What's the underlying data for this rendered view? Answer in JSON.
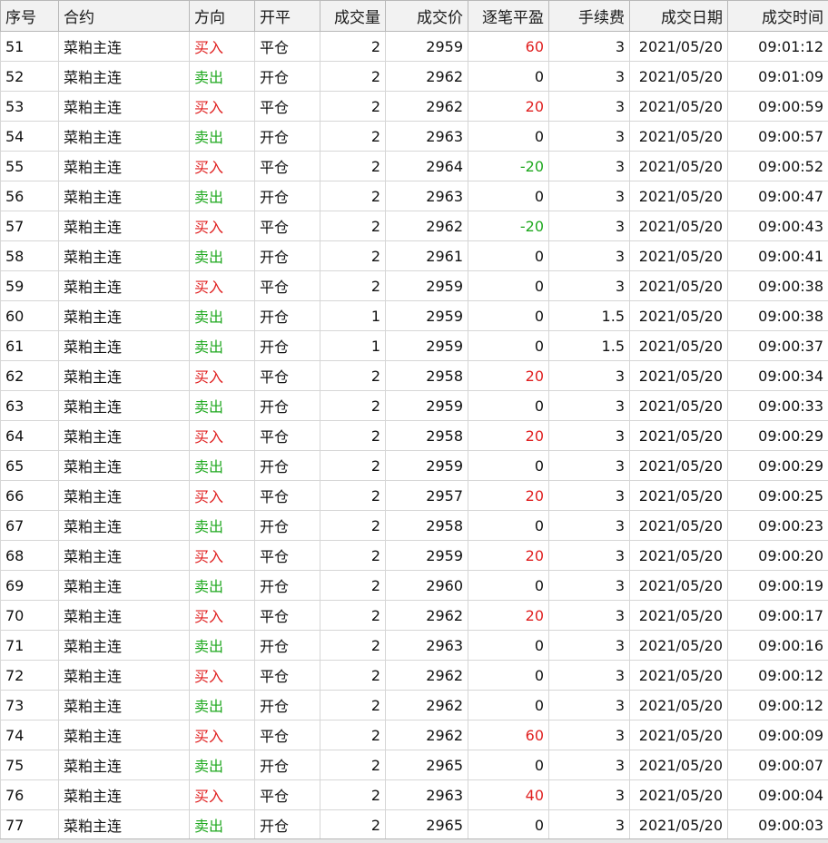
{
  "columns": [
    "序号",
    "合约",
    "方向",
    "开平",
    "成交量",
    "成交价",
    "逐笔平盈",
    "手续费",
    "成交日期",
    "成交时间"
  ],
  "rows": [
    [
      "51",
      "菜粕主连",
      "买入",
      "平仓",
      "2",
      "2959",
      "60",
      "3",
      "2021/05/20",
      "09:01:12"
    ],
    [
      "52",
      "菜粕主连",
      "卖出",
      "开仓",
      "2",
      "2962",
      "0",
      "3",
      "2021/05/20",
      "09:01:09"
    ],
    [
      "53",
      "菜粕主连",
      "买入",
      "平仓",
      "2",
      "2962",
      "20",
      "3",
      "2021/05/20",
      "09:00:59"
    ],
    [
      "54",
      "菜粕主连",
      "卖出",
      "开仓",
      "2",
      "2963",
      "0",
      "3",
      "2021/05/20",
      "09:00:57"
    ],
    [
      "55",
      "菜粕主连",
      "买入",
      "平仓",
      "2",
      "2964",
      "-20",
      "3",
      "2021/05/20",
      "09:00:52"
    ],
    [
      "56",
      "菜粕主连",
      "卖出",
      "开仓",
      "2",
      "2963",
      "0",
      "3",
      "2021/05/20",
      "09:00:47"
    ],
    [
      "57",
      "菜粕主连",
      "买入",
      "平仓",
      "2",
      "2962",
      "-20",
      "3",
      "2021/05/20",
      "09:00:43"
    ],
    [
      "58",
      "菜粕主连",
      "卖出",
      "开仓",
      "2",
      "2961",
      "0",
      "3",
      "2021/05/20",
      "09:00:41"
    ],
    [
      "59",
      "菜粕主连",
      "买入",
      "平仓",
      "2",
      "2959",
      "0",
      "3",
      "2021/05/20",
      "09:00:38"
    ],
    [
      "60",
      "菜粕主连",
      "卖出",
      "开仓",
      "1",
      "2959",
      "0",
      "1.5",
      "2021/05/20",
      "09:00:38"
    ],
    [
      "61",
      "菜粕主连",
      "卖出",
      "开仓",
      "1",
      "2959",
      "0",
      "1.5",
      "2021/05/20",
      "09:00:37"
    ],
    [
      "62",
      "菜粕主连",
      "买入",
      "平仓",
      "2",
      "2958",
      "20",
      "3",
      "2021/05/20",
      "09:00:34"
    ],
    [
      "63",
      "菜粕主连",
      "卖出",
      "开仓",
      "2",
      "2959",
      "0",
      "3",
      "2021/05/20",
      "09:00:33"
    ],
    [
      "64",
      "菜粕主连",
      "买入",
      "平仓",
      "2",
      "2958",
      "20",
      "3",
      "2021/05/20",
      "09:00:29"
    ],
    [
      "65",
      "菜粕主连",
      "卖出",
      "开仓",
      "2",
      "2959",
      "0",
      "3",
      "2021/05/20",
      "09:00:29"
    ],
    [
      "66",
      "菜粕主连",
      "买入",
      "平仓",
      "2",
      "2957",
      "20",
      "3",
      "2021/05/20",
      "09:00:25"
    ],
    [
      "67",
      "菜粕主连",
      "卖出",
      "开仓",
      "2",
      "2958",
      "0",
      "3",
      "2021/05/20",
      "09:00:23"
    ],
    [
      "68",
      "菜粕主连",
      "买入",
      "平仓",
      "2",
      "2959",
      "20",
      "3",
      "2021/05/20",
      "09:00:20"
    ],
    [
      "69",
      "菜粕主连",
      "卖出",
      "开仓",
      "2",
      "2960",
      "0",
      "3",
      "2021/05/20",
      "09:00:19"
    ],
    [
      "70",
      "菜粕主连",
      "买入",
      "平仓",
      "2",
      "2962",
      "20",
      "3",
      "2021/05/20",
      "09:00:17"
    ],
    [
      "71",
      "菜粕主连",
      "卖出",
      "开仓",
      "2",
      "2963",
      "0",
      "3",
      "2021/05/20",
      "09:00:16"
    ],
    [
      "72",
      "菜粕主连",
      "买入",
      "平仓",
      "2",
      "2962",
      "0",
      "3",
      "2021/05/20",
      "09:00:12"
    ],
    [
      "73",
      "菜粕主连",
      "卖出",
      "开仓",
      "2",
      "2962",
      "0",
      "3",
      "2021/05/20",
      "09:00:12"
    ],
    [
      "74",
      "菜粕主连",
      "买入",
      "平仓",
      "2",
      "2962",
      "60",
      "3",
      "2021/05/20",
      "09:00:09"
    ],
    [
      "75",
      "菜粕主连",
      "卖出",
      "开仓",
      "2",
      "2965",
      "0",
      "3",
      "2021/05/20",
      "09:00:07"
    ],
    [
      "76",
      "菜粕主连",
      "买入",
      "平仓",
      "2",
      "2963",
      "40",
      "3",
      "2021/05/20",
      "09:00:04"
    ],
    [
      "77",
      "菜粕主连",
      "卖出",
      "开仓",
      "2",
      "2965",
      "0",
      "3",
      "2021/05/20",
      "09:00:03"
    ]
  ],
  "colors": {
    "buy": "#e02020",
    "sell": "#1fa81f",
    "profit_positive": "#e02020",
    "profit_negative": "#1fa81f",
    "header_bg": "#f2f2f2",
    "grid_line": "#d6d6d6"
  }
}
